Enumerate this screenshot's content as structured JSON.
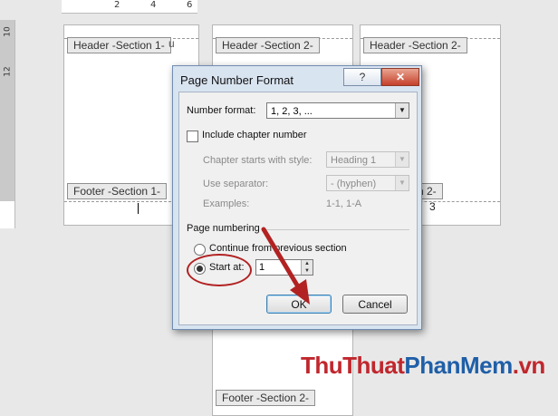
{
  "ruler": {
    "top_ticks": [
      "2",
      "4",
      "6"
    ],
    "left_ticks": [
      "10",
      "12"
    ]
  },
  "pages": {
    "header_left": "Header -Section 1-",
    "header_mid": "Header -Section 2-",
    "header_right": "Header -Section 2-",
    "footer_left": "Footer -Section 1-",
    "footer_right_tail": "n 2-",
    "footer_bottom": "Footer -Section 2-",
    "page_number_right": "3",
    "header_left_extra": "u"
  },
  "dialog": {
    "title": "Page Number Format",
    "help_label": "?",
    "close_label": "✕",
    "number_format_label": "Number format:",
    "number_format_value": "1, 2, 3, ...",
    "include_chapter_label": "Include chapter number",
    "chapter_style_label": "Chapter starts with style:",
    "chapter_style_value": "Heading 1",
    "separator_label": "Use separator:",
    "separator_value": "-   (hyphen)",
    "examples_label": "Examples:",
    "examples_value": "1-1, 1-A",
    "page_numbering_label": "Page numbering",
    "continue_label": "Continue from previous section",
    "start_at_label": "Start at:",
    "start_at_value": "1",
    "ok_label": "OK",
    "cancel_label": "Cancel"
  },
  "watermark": {
    "part1": "ThuThuat",
    "part2": "PhanMem",
    "part3": ".vn"
  },
  "colors": {
    "annotation_red": "#b22222",
    "watermark_red": "#c0272d",
    "watermark_blue": "#1f5fa8"
  }
}
